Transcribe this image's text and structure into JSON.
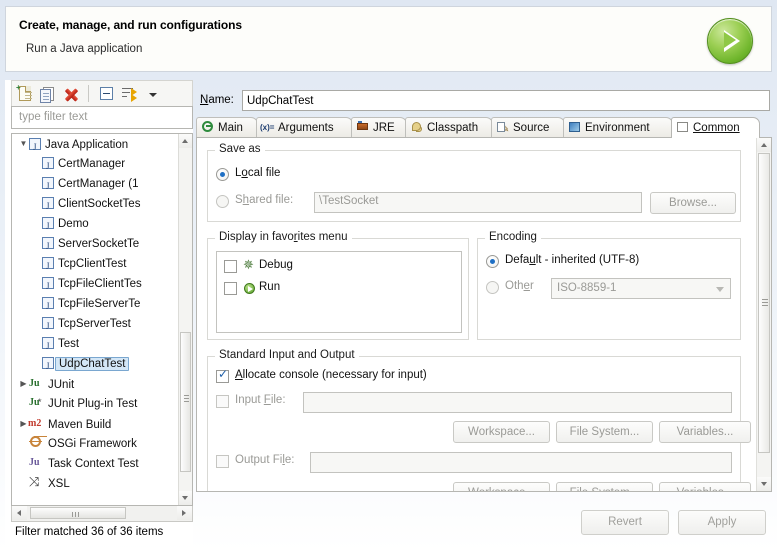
{
  "header": {
    "title": "Create, manage, and run configurations",
    "subtitle": "Run a Java application",
    "run_button_icon": "run-play-icon"
  },
  "toolbar": {
    "new_label": "new-configuration-icon",
    "duplicate_label": "duplicate-configuration-icon",
    "delete_label": "delete-configuration-icon",
    "collapse_label": "collapse-all-icon",
    "filter_label": "filter-configurations-icon",
    "menu_label": "view-menu-chevron-icon"
  },
  "filter": {
    "placeholder": "type filter text",
    "status": "Filter matched 36 of 36 items"
  },
  "tree": [
    {
      "label": "Java Application",
      "icon": "java-icon",
      "level": 0,
      "expanded": true,
      "selected": false
    },
    {
      "label": "CertManager",
      "icon": "java-icon",
      "level": 1,
      "selected": false
    },
    {
      "label": "CertManager (1",
      "icon": "java-icon",
      "level": 1,
      "selected": false
    },
    {
      "label": "ClientSocketTes",
      "icon": "java-icon",
      "level": 1,
      "selected": false
    },
    {
      "label": "Demo",
      "icon": "java-icon",
      "level": 1,
      "selected": false
    },
    {
      "label": "ServerSocketTe",
      "icon": "java-icon",
      "level": 1,
      "selected": false
    },
    {
      "label": "TcpClientTest",
      "icon": "java-icon",
      "level": 1,
      "selected": false
    },
    {
      "label": "TcpFileClientTes",
      "icon": "java-icon",
      "level": 1,
      "selected": false
    },
    {
      "label": "TcpFileServerTe",
      "icon": "java-icon",
      "level": 1,
      "selected": false
    },
    {
      "label": "TcpServerTest",
      "icon": "java-icon",
      "level": 1,
      "selected": false
    },
    {
      "label": "Test",
      "icon": "java-icon",
      "level": 1,
      "selected": false
    },
    {
      "label": "UdpChatTest",
      "icon": "java-icon",
      "level": 1,
      "selected": true
    },
    {
      "label": "JUnit",
      "icon": "junit-icon",
      "level": 0,
      "expanded": false,
      "selected": false
    },
    {
      "label": "JUnit Plug-in Test",
      "icon": "junit-plugin-icon",
      "level": 0,
      "selected": false
    },
    {
      "label": "Maven Build",
      "icon": "maven-icon",
      "level": 0,
      "expanded": false,
      "selected": false
    },
    {
      "label": "OSGi Framework",
      "icon": "osgi-icon",
      "level": 0,
      "selected": false
    },
    {
      "label": "Task Context Test",
      "icon": "task-context-icon",
      "level": 0,
      "selected": false
    },
    {
      "label": "XSL",
      "icon": "xsl-icon",
      "level": 0,
      "selected": false
    }
  ],
  "name": {
    "label": "Name:",
    "value": "UdpChatTest"
  },
  "tabs": [
    {
      "label": "Main",
      "icon": "main-tab-icon",
      "active": false
    },
    {
      "label": "Arguments",
      "icon": "arguments-tab-icon",
      "active": false
    },
    {
      "label": "JRE",
      "icon": "jre-tab-icon",
      "active": false
    },
    {
      "label": "Classpath",
      "icon": "classpath-tab-icon",
      "active": false
    },
    {
      "label": "Source",
      "icon": "source-tab-icon",
      "active": false
    },
    {
      "label": "Environment",
      "icon": "environment-tab-icon",
      "active": false
    },
    {
      "label": "Common",
      "icon": "common-tab-icon",
      "active": true
    }
  ],
  "common": {
    "save_as": {
      "title": "Save as",
      "local_file_label": "Local file",
      "local_file_selected": true,
      "shared_file_label": "Shared file:",
      "shared_file_selected": false,
      "shared_file_value": "\\TestSocket",
      "browse_label": "Browse..."
    },
    "favorites": {
      "title": "Display in favorites menu",
      "items": [
        {
          "label": "Debug",
          "icon": "debug-bug-icon",
          "checked": false
        },
        {
          "label": "Run",
          "icon": "run-play-icon",
          "checked": false
        }
      ]
    },
    "encoding": {
      "title": "Encoding",
      "default_label": "Default - inherited (UTF-8)",
      "default_selected": true,
      "other_label": "Other",
      "other_selected": false,
      "other_value": "ISO-8859-1"
    },
    "std_io": {
      "title": "Standard Input and Output",
      "allocate_console_label": "Allocate console (necessary for input)",
      "allocate_console_checked": true,
      "input_file_label": "Input File:",
      "input_file_checked": false,
      "input_file_value": "",
      "output_file_label": "Output File:",
      "output_file_checked": false,
      "output_file_value": "",
      "workspace_label": "Workspace...",
      "file_system_label": "File System...",
      "variables_label": "Variables..."
    }
  },
  "footer": {
    "revert_label": "Revert",
    "apply_label": "Apply"
  },
  "colors": {
    "accent_blue": "#1f6fc4",
    "selection_bg": "#d4e7f7",
    "selection_border": "#7aa7d0",
    "run_green": "#6eb52b",
    "delete_red": "#b41c11"
  }
}
